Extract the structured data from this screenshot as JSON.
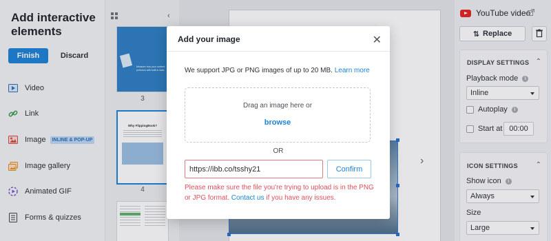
{
  "left_panel": {
    "title": "Add interactive elements",
    "finish_label": "Finish",
    "discard_label": "Discard",
    "items": [
      {
        "label": "Video",
        "icon": "video-icon"
      },
      {
        "label": "Link",
        "icon": "link-icon"
      },
      {
        "label": "Image",
        "icon": "image-icon",
        "badge": "INLINE & POP-UP"
      },
      {
        "label": "Image gallery",
        "icon": "gallery-icon"
      },
      {
        "label": "Animated GIF",
        "icon": "gif-icon"
      },
      {
        "label": "Forms & quizzes",
        "icon": "forms-icon"
      }
    ]
  },
  "thumbnails": {
    "page_numbers": [
      "3",
      "4"
    ],
    "thumb1_text": "Measure how your content performs with built-in stats",
    "thumb2_title": "Why FlippingBook?"
  },
  "right_panel": {
    "element_title": "YouTube video",
    "replace_label": "Replace",
    "display_settings": {
      "header": "DISPLAY SETTINGS",
      "playback_label": "Playback mode",
      "playback_value": "Inline",
      "autoplay_label": "Autoplay",
      "start_label": "Start at",
      "start_value": "00:00"
    },
    "icon_settings": {
      "header": "ICON SETTINGS",
      "show_icon_label": "Show icon",
      "show_icon_value": "Always",
      "size_label": "Size",
      "size_value": "Large"
    }
  },
  "modal": {
    "title": "Add your image",
    "support_text": "We support JPG or PNG images of up to 20 MB.",
    "learn_more": "Learn more",
    "drop_text": "Drag an image here or",
    "browse_label": "browse",
    "or_text": "OR",
    "url_value": "https://ibb.co/tsshy21",
    "confirm_label": "Confirm",
    "error_text_1": "Please make sure the file you're trying to upload is in the PNG or JPG format.",
    "error_link": "Contact us",
    "error_text_2": "if you have any issues."
  },
  "colors": {
    "accent": "#1c82d6",
    "error": "#e04e5a",
    "youtube": "#e52521"
  }
}
